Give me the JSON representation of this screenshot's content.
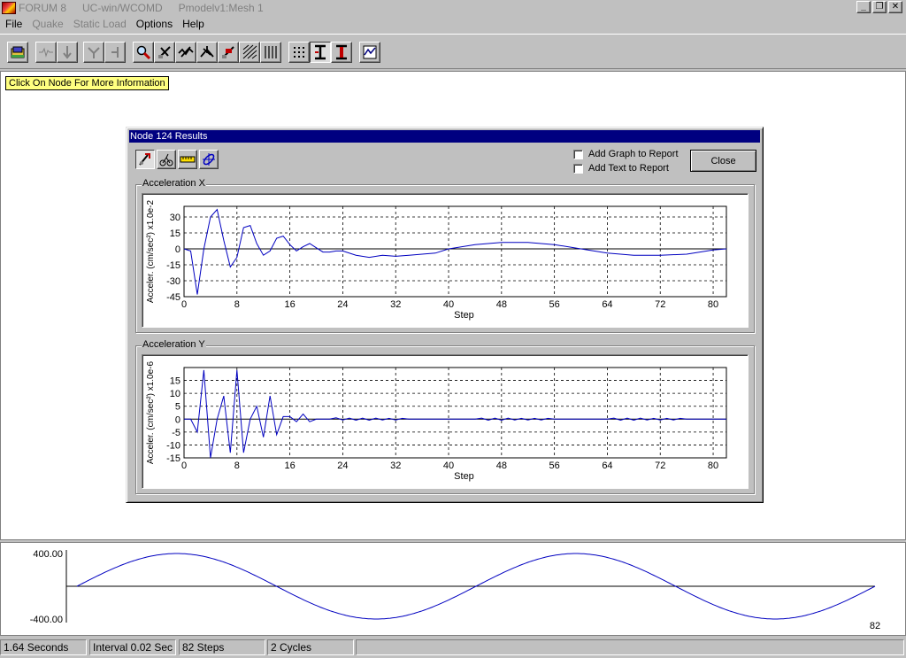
{
  "window": {
    "title_parts": [
      "FORUM 8",
      "UC-win/WCOMD",
      "Pmodelv1:Mesh 1"
    ],
    "minimize_glyph": "_",
    "restore_glyph": "❐",
    "close_glyph": "✕"
  },
  "menu": {
    "file": "File",
    "quake": "Quake",
    "static_load": "Static Load",
    "options": "Options",
    "help": "Help"
  },
  "hint": "Click On Node For More Information",
  "dialog": {
    "title": "Node 124 Results",
    "add_graph_label": "Add Graph to Report",
    "add_text_label": "Add Text to Report",
    "close_label": "Close",
    "group_x_label": "Acceleration X",
    "group_y_label": "Acceleration Y"
  },
  "chart_data": [
    {
      "type": "line",
      "title": "Acceleration X",
      "xlabel": "Step",
      "ylabel": "Acceler. (cm/sec²) x1.0e-2",
      "xlim": [
        0,
        82
      ],
      "ylim": [
        -45,
        40
      ],
      "x_ticks": [
        0,
        8,
        16,
        24,
        32,
        40,
        48,
        56,
        64,
        72,
        80
      ],
      "y_ticks": [
        30,
        15,
        0,
        -15,
        -30,
        -45
      ],
      "grid": true,
      "series": [
        {
          "color": "#0000c0",
          "x": [
            0,
            1,
            2,
            3,
            4,
            5,
            6,
            7,
            8,
            9,
            10,
            11,
            12,
            13,
            14,
            15,
            16,
            17,
            18,
            19,
            20,
            21,
            22,
            23,
            24,
            26,
            28,
            30,
            32,
            34,
            36,
            38,
            40,
            44,
            48,
            52,
            56,
            60,
            64,
            68,
            72,
            76,
            80,
            82
          ],
          "y": [
            0,
            -2,
            -43,
            0,
            30,
            37,
            8,
            -17,
            -8,
            20,
            22,
            5,
            -6,
            -2,
            10,
            12,
            4,
            -2,
            2,
            5,
            1,
            -3,
            -3,
            -2,
            -2,
            -6,
            -8,
            -6,
            -7,
            -6,
            -5,
            -4,
            0,
            4,
            6,
            6,
            4,
            0,
            -4,
            -6,
            -6,
            -5,
            -1,
            0
          ]
        }
      ]
    },
    {
      "type": "line",
      "title": "Acceleration Y",
      "xlabel": "Step",
      "ylabel": "Acceler. (cm/sec²) x1.0e-6",
      "xlim": [
        0,
        82
      ],
      "ylim": [
        -15,
        20
      ],
      "x_ticks": [
        0,
        8,
        16,
        24,
        32,
        40,
        48,
        56,
        64,
        72,
        80
      ],
      "y_ticks": [
        15,
        10,
        5,
        0,
        -5,
        -10,
        -15
      ],
      "grid": true,
      "series": [
        {
          "color": "#0000c0",
          "x": [
            0,
            1,
            2,
            3,
            4,
            5,
            6,
            7,
            8,
            9,
            10,
            11,
            12,
            13,
            14,
            15,
            16,
            17,
            18,
            19,
            20,
            22,
            23,
            24,
            25,
            26,
            27,
            28,
            29,
            30,
            31,
            32,
            33,
            34,
            40,
            44,
            45,
            46,
            47,
            48,
            49,
            50,
            51,
            52,
            53,
            54,
            55,
            56,
            60,
            64,
            65,
            66,
            67,
            68,
            69,
            70,
            71,
            72,
            73,
            74,
            75,
            76,
            82
          ],
          "y": [
            0,
            0,
            -5,
            19,
            -15,
            0,
            9,
            -13,
            19,
            -13,
            0,
            5,
            -7,
            9,
            -6,
            1,
            1,
            -1,
            2,
            -1,
            0,
            0,
            0.5,
            -0.3,
            0.4,
            -0.4,
            0.4,
            -0.4,
            0.4,
            -0.3,
            0.3,
            -0.3,
            0.3,
            0,
            0,
            0,
            0.4,
            -0.4,
            0.4,
            -0.4,
            0.4,
            -0.3,
            0.3,
            -0.3,
            0.3,
            -0.3,
            0.3,
            0,
            0,
            0,
            0.4,
            -0.4,
            0.4,
            -0.4,
            0.4,
            -0.3,
            0.3,
            -0.3,
            0.3,
            -0.3,
            0.3,
            0,
            0
          ]
        }
      ]
    },
    {
      "type": "line",
      "title": "",
      "ylim": [
        -400,
        400
      ],
      "y_ticks": [
        400,
        -400
      ],
      "cycles": 2,
      "steps": 82,
      "grid": false,
      "series": [
        {
          "color": "#0000c0",
          "note": "sine wave",
          "amplitude": 400,
          "cycles": 2
        }
      ]
    }
  ],
  "wave": {
    "max_label": "400.00",
    "min_label": "-400.00",
    "end_label": "82"
  },
  "status": {
    "duration": "1.64 Seconds",
    "interval": "Interval 0.02 Sec",
    "steps": "82 Steps",
    "cycles": "2 Cycles"
  }
}
